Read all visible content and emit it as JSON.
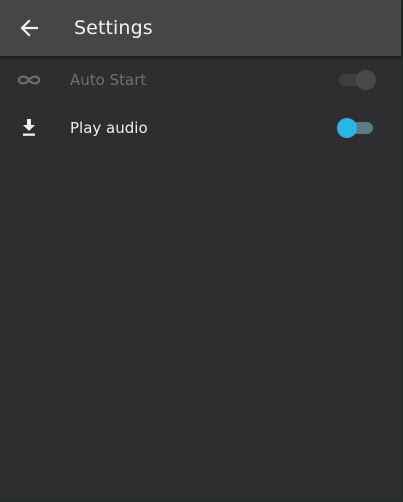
{
  "app_bar": {
    "title": "Settings",
    "back_icon": "arrow-back-icon"
  },
  "settings": [
    {
      "label": "Auto Start",
      "icon": "infinity-icon",
      "enabled": false,
      "switch_on": false
    },
    {
      "label": "Play audio",
      "icon": "download-icon",
      "enabled": true,
      "switch_on": true
    }
  ],
  "colors": {
    "app_bar_bg": "#464646",
    "background": "#2e2e2e",
    "accent": "#29b6e6",
    "disabled_text": "#707070",
    "primary_text": "#f0f0f0"
  }
}
